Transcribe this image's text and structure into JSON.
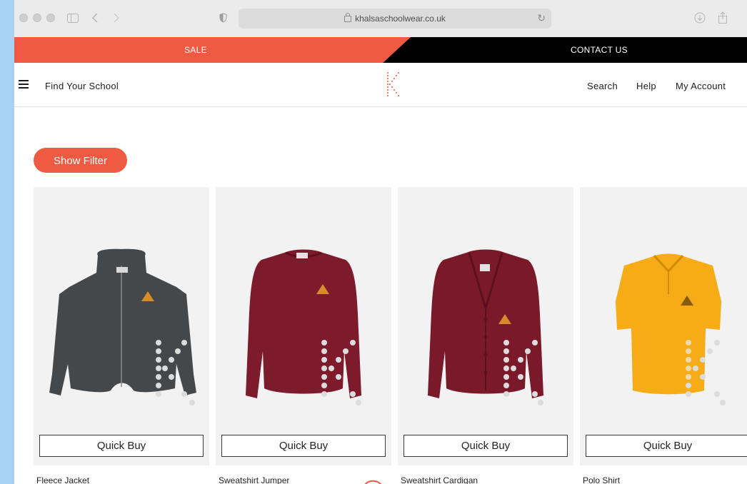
{
  "browser": {
    "url": "khalsaschoolwear.co.uk"
  },
  "promo": {
    "sale_label": "SALE",
    "contact_label": "CONTACT US",
    "sale_color": "#ee5a42",
    "contact_color": "#000000"
  },
  "header": {
    "find_school": "Find Your School",
    "logo_letter": "K",
    "nav": [
      "Search",
      "Help",
      "My Account"
    ]
  },
  "filter": {
    "label": "Show Filter"
  },
  "products": [
    {
      "name": "Fleece Jacket",
      "button": "Quick Buy",
      "color": "#45484b"
    },
    {
      "name": "Sweatshirt Jumper",
      "button": "Quick Buy",
      "color": "#7d1a2b"
    },
    {
      "name": "Sweatshirt Cardigan",
      "button": "Quick Buy",
      "color": "#7a1929"
    },
    {
      "name": "Polo Shirt",
      "button": "Quick Buy",
      "color": "#f5ac16"
    }
  ],
  "colors": {
    "accent": "#ee5a42",
    "card_bg": "#f2f2f2",
    "page_bg": "#a7d2f4"
  }
}
